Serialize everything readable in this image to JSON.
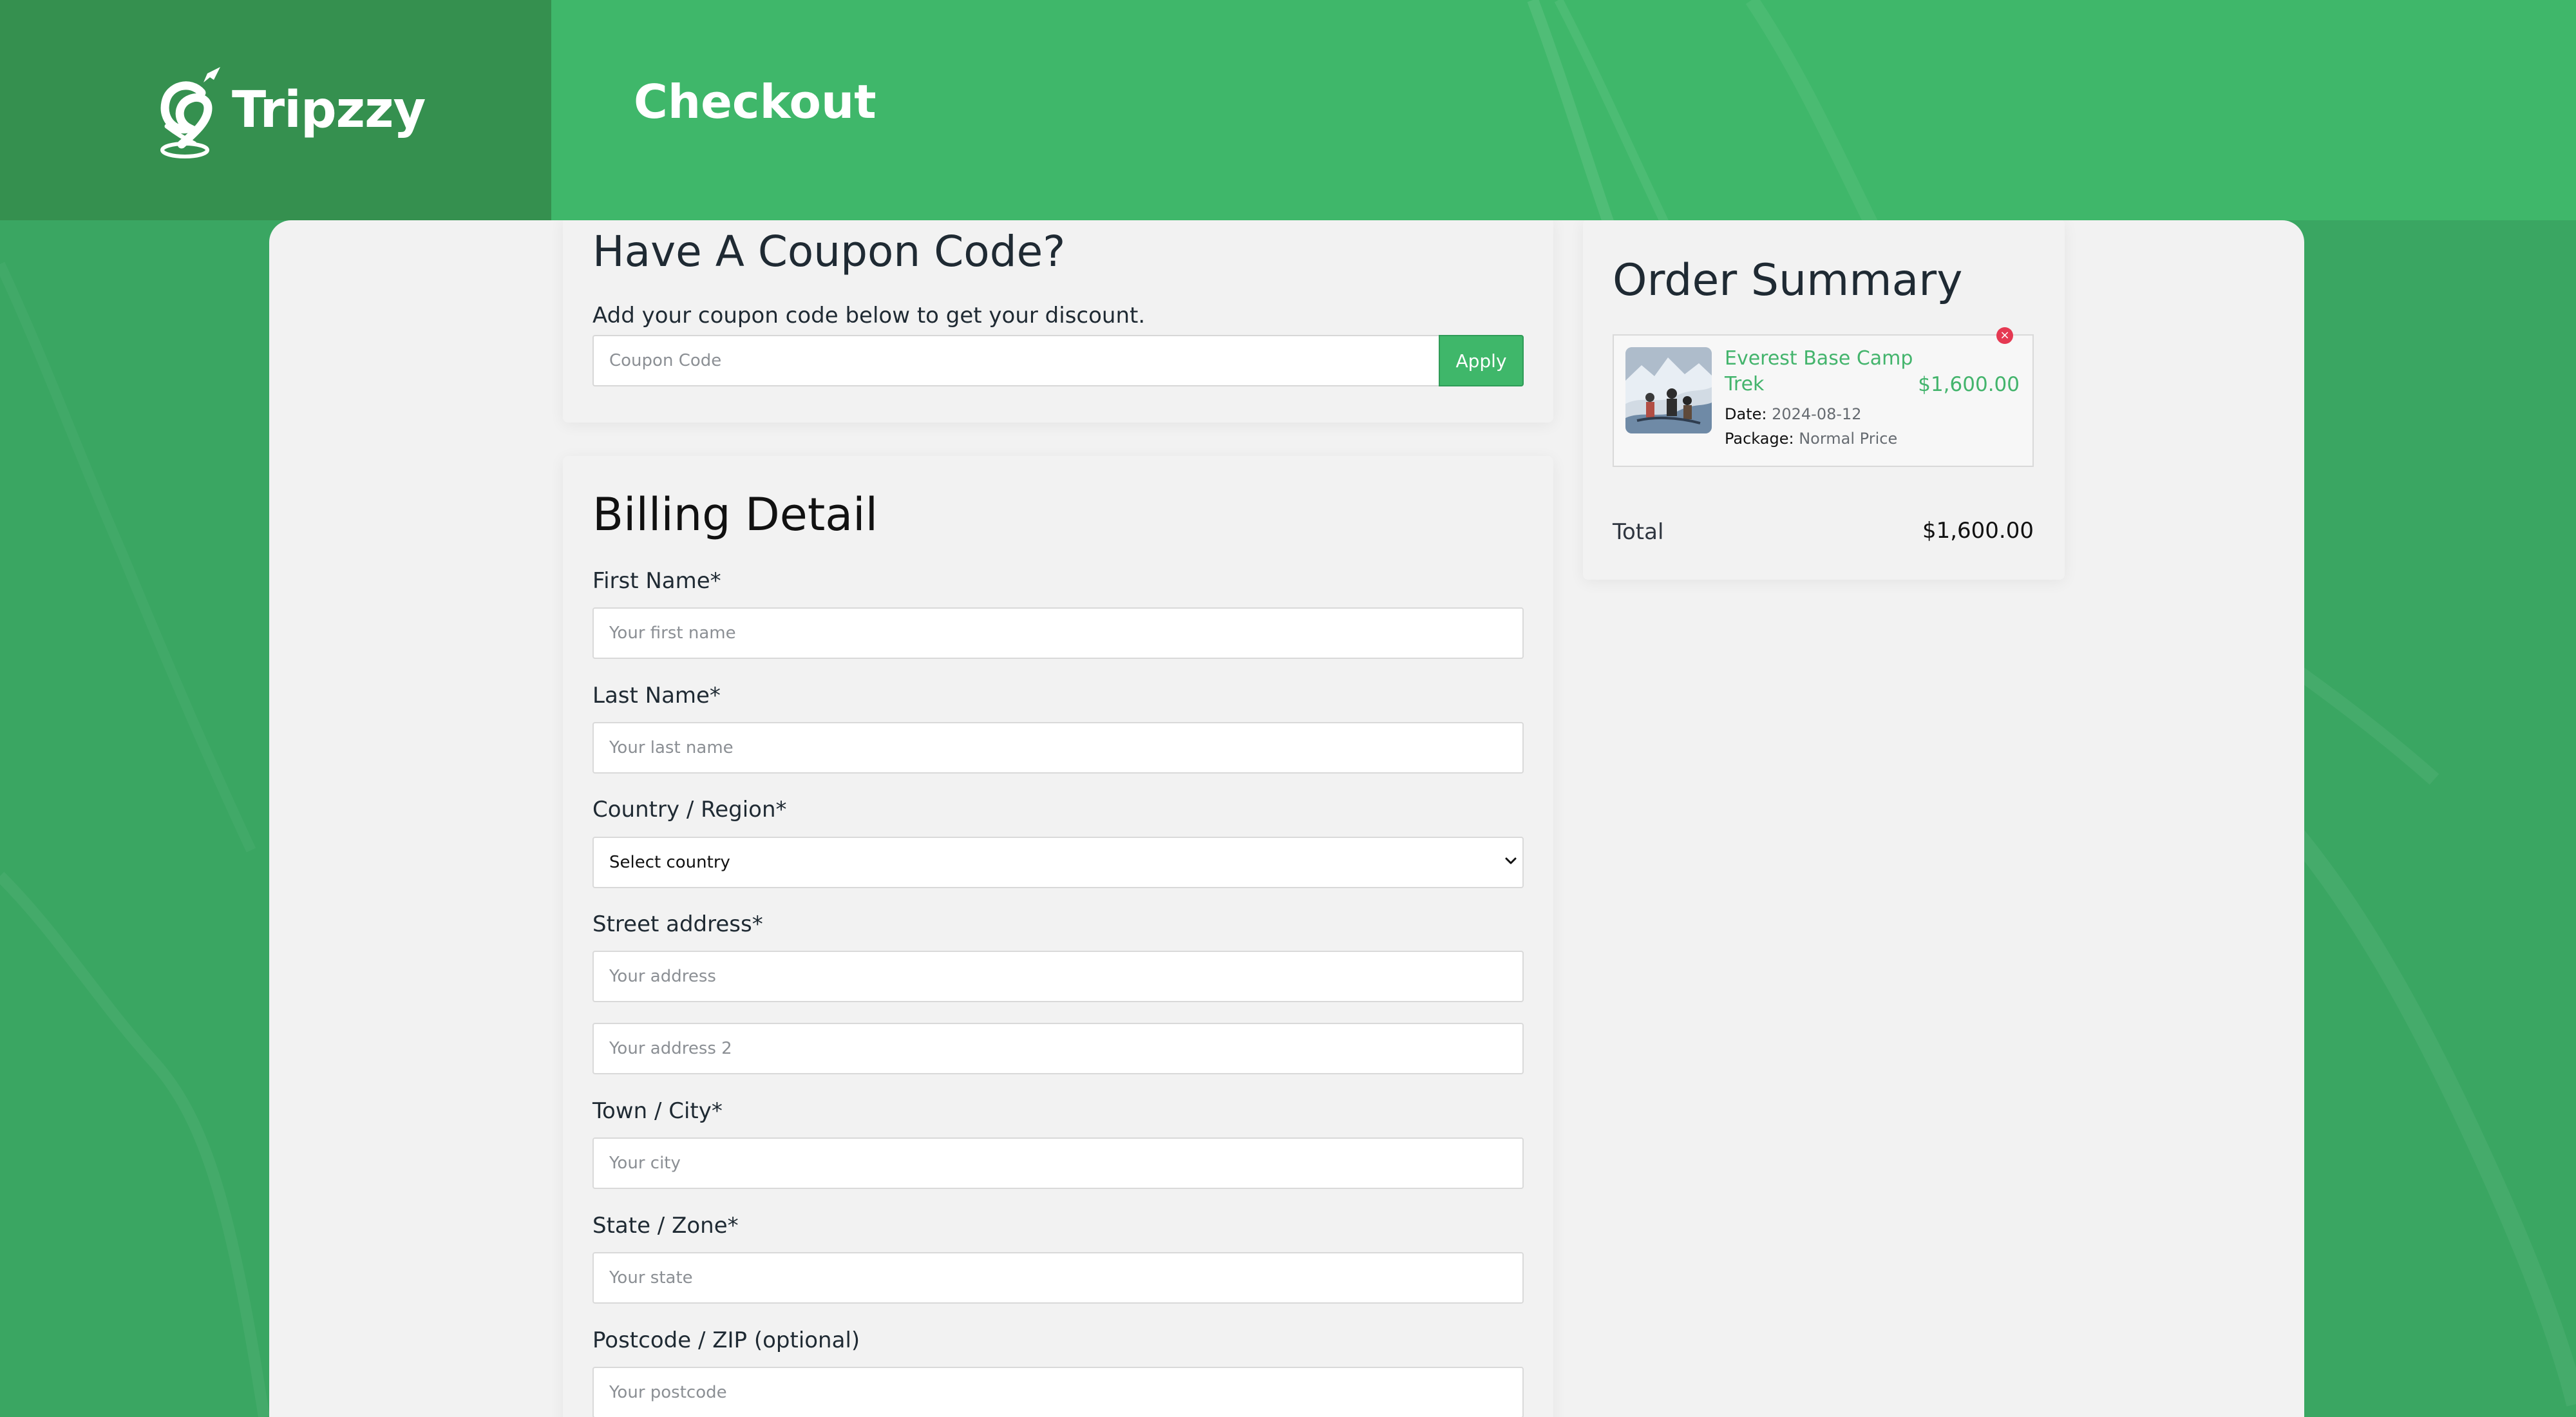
{
  "brand": {
    "name": "Tripzzy"
  },
  "header": {
    "title": "Checkout"
  },
  "coupon": {
    "title": "Have A Coupon Code?",
    "description": "Add your coupon code below to get your discount.",
    "placeholder": "Coupon Code",
    "apply_label": "Apply"
  },
  "billing": {
    "title": "Billing Detail",
    "fields": {
      "first_name_label": "First Name*",
      "first_name_placeholder": "Your first name",
      "last_name_label": "Last Name*",
      "last_name_placeholder": "Your last name",
      "country_label": "Country / Region*",
      "country_selected": "Select country",
      "street_label": "Street address*",
      "street_placeholder": "Your address",
      "street2_placeholder": "Your address 2",
      "city_label": "Town / City*",
      "city_placeholder": "Your city",
      "state_label": "State / Zone*",
      "state_placeholder": "Your state",
      "postcode_label": "Postcode / ZIP (optional)",
      "postcode_placeholder": "Your postcode"
    }
  },
  "summary": {
    "title": "Order Summary",
    "item": {
      "name_line1": "Everest Base Camp",
      "name_line2": "Trek",
      "price": "$1,600.00",
      "date_label": "Date:",
      "date_value": "2024-08-12",
      "package_label": "Package:",
      "package_value": "Normal Price"
    },
    "total_label": "Total",
    "total_value": "$1,600.00"
  },
  "colors": {
    "brand_green": "#3fb76a",
    "dark_green": "#35904f",
    "remove_red": "#e53952"
  },
  "icons": {
    "logo": "tripzzy-logo-icon",
    "remove": "close-circle-icon",
    "dropdown": "chevron-down-icon"
  }
}
